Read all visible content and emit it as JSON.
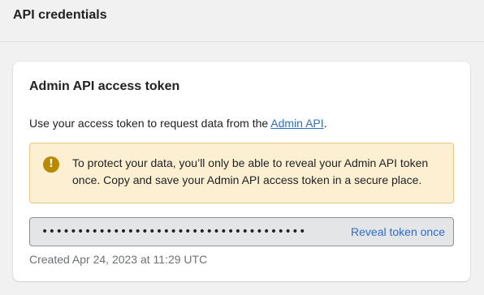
{
  "header": {
    "title": "API credentials"
  },
  "card": {
    "title": "Admin API access token",
    "description_prefix": "Use your access token to request data from the ",
    "description_link": "Admin API",
    "description_suffix": ".",
    "banner": {
      "icon": "exclamation-icon",
      "text": "To protect your data, you’ll only be able to reveal your Admin API token once. Copy and save your Admin API access token in a secure place."
    },
    "token": {
      "masked_value": "•••••••••••••••••••••••••••••••••••••",
      "reveal_label": "Reveal token once"
    },
    "created": "Created Apr 24, 2023 at 11:29 UTC"
  },
  "colors": {
    "link": "#2c6ecb",
    "banner_background": "#fdf0d2",
    "banner_icon": "#b98900",
    "token_background": "#e4e5e7",
    "muted_text": "#6d7175"
  }
}
